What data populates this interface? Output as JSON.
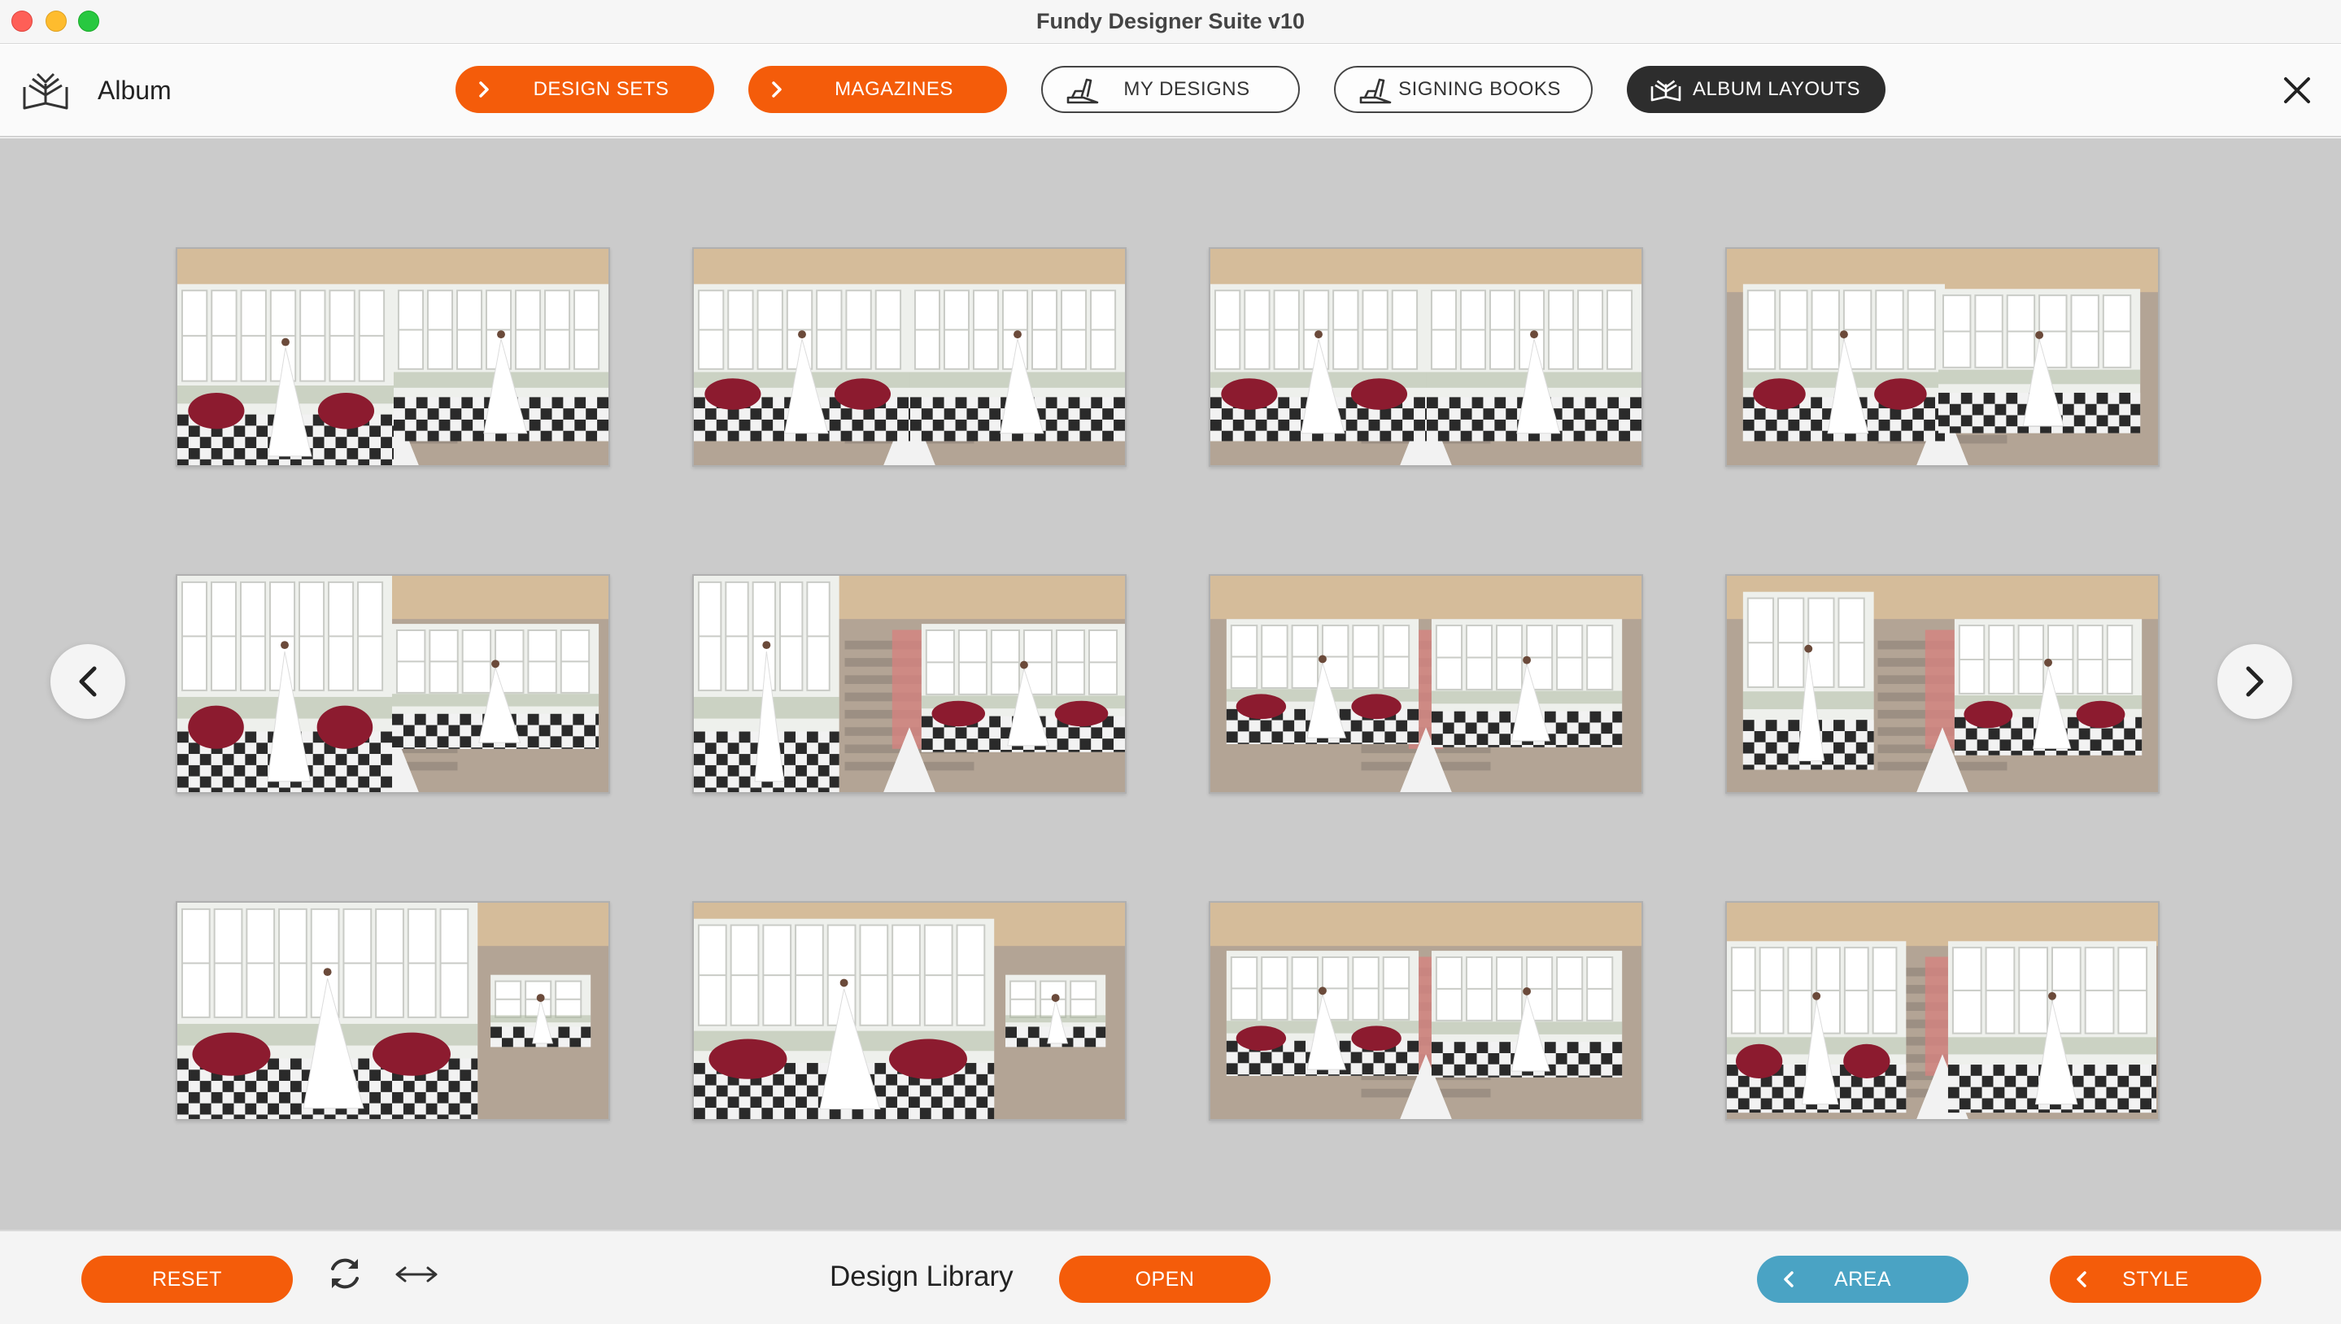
{
  "window": {
    "title": "Fundy Designer Suite v10"
  },
  "header": {
    "app_label": "Album",
    "app_icon": "album-book-icon",
    "nav": [
      {
        "label": "DESIGN SETS",
        "icon": "chevron-right-icon",
        "style": "orange"
      },
      {
        "label": "MAGAZINES",
        "icon": "chevron-right-icon",
        "style": "orange"
      },
      {
        "label": "MY DESIGNS",
        "icon": "hand-book-icon",
        "style": "outline"
      },
      {
        "label": "SIGNING BOOKS",
        "icon": "hand-book-icon",
        "style": "outline"
      },
      {
        "label": "ALBUM LAYOUTS",
        "icon": "album-book-icon",
        "style": "dark"
      }
    ],
    "close_icon": "close-icon"
  },
  "gallery": {
    "prev_icon": "chevron-left-icon",
    "next_icon": "chevron-right-icon",
    "layout_count_shown": 12
  },
  "footer": {
    "reset_label": "RESET",
    "refresh_icon": "refresh-icon",
    "swap_icon": "swap-horizontal-icon",
    "library_label": "Design Library",
    "open_label": "OPEN",
    "area_label": "AREA",
    "style_label": "STYLE"
  },
  "colors": {
    "accent_orange": "#f45c0a",
    "area_blue": "#4aa3c4",
    "dark_button": "#2d2d2d",
    "canvas_gray": "#cbcbcb"
  }
}
